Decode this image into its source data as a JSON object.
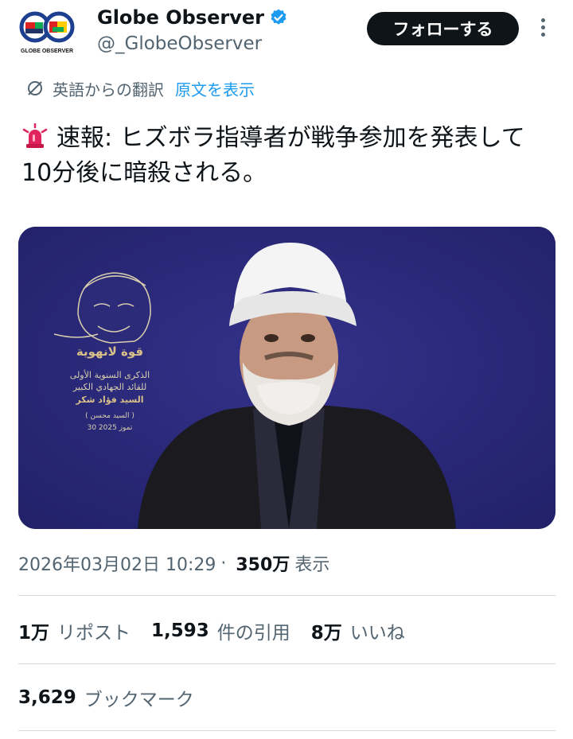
{
  "account": {
    "display_name": "Globe Observer",
    "handle": "@_GlobeObserver",
    "avatar_caption": "GLOBE OBSERVER",
    "verified": true
  },
  "follow_button": {
    "label": "フォローする"
  },
  "translation": {
    "label": "英語からの翻訳",
    "show_original": "原文を表示"
  },
  "tweet": {
    "text": "速報: ヒズボラ指導者が戦争参加を発表して10分後に暗殺される。",
    "emoji_icon": "rotating-light"
  },
  "media": {
    "poster_lines": [
      "الذكرى السنوية الأولى",
      "للقائد الجهادي الكبير",
      "السيد فؤاد شكر",
      "( السيد محسن )",
      "30 تموز 2025"
    ],
    "poster_title": "قوة لانهوية"
  },
  "meta": {
    "timestamp": "2026年03月02日 10:29",
    "separator": "·",
    "views_count": "350万",
    "views_label": "表示"
  },
  "stats": {
    "reposts_count": "1万",
    "reposts_label": "リポスト",
    "quotes_count": "1,593",
    "quotes_label": "件の引用",
    "likes_count": "8万",
    "likes_label": "いいね"
  },
  "bookmarks": {
    "count": "3,629",
    "label": "ブックマーク"
  },
  "colors": {
    "accent": "#1d9bf0",
    "secondary_text": "#536471",
    "primary_text": "#0f1419",
    "media_background": "#2c2b7a"
  }
}
